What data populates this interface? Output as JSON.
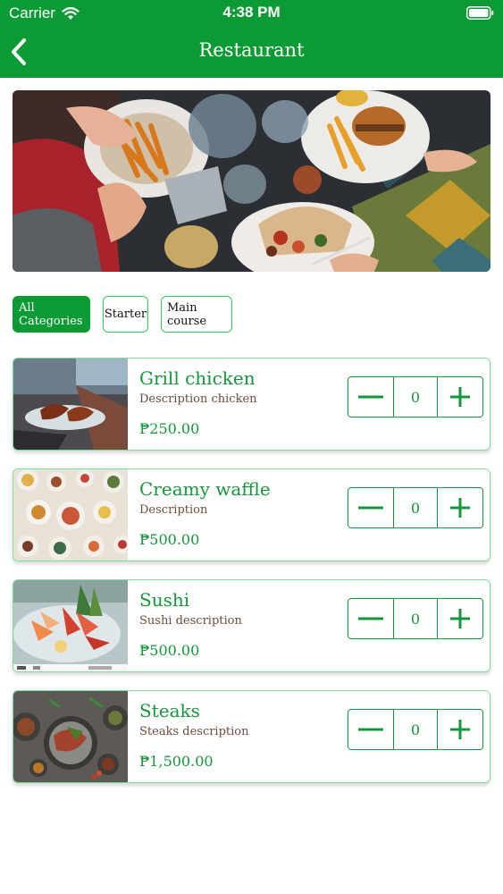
{
  "status_bar": {
    "carrier": "Carrier",
    "time": "4:38 PM"
  },
  "nav": {
    "title": "Restaurant"
  },
  "categories": [
    "All Categories",
    "Starter",
    "Main course"
  ],
  "selected_category": "All Categories",
  "menu_items": [
    {
      "name": "Grill chicken",
      "description": "Description chicken",
      "price": "₱250.00",
      "quantity": "0"
    },
    {
      "name": "Creamy waffle",
      "description": "Description",
      "price": "₱500.00",
      "quantity": "0"
    },
    {
      "name": "Sushi",
      "description": "Sushi description",
      "price": "₱500.00",
      "quantity": "0"
    },
    {
      "name": "Steaks",
      "description": "Steaks description",
      "price": "₱1,500.00",
      "quantity": "0"
    }
  ],
  "colors": {
    "primary": "#0c9a34",
    "accent_text": "#16963a",
    "chip_border": "#41c65f",
    "description": "#6b4e3a"
  },
  "icons": [
    "wifi-icon",
    "battery-icon",
    "back-icon",
    "minus-icon",
    "plus-icon"
  ]
}
